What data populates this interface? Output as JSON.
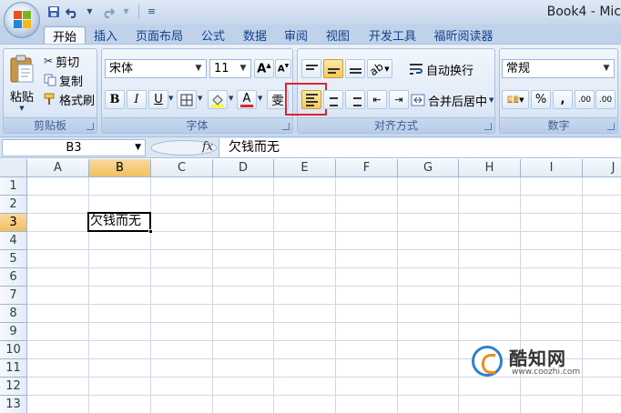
{
  "window": {
    "title": "Book4 - Mic"
  },
  "qat": {
    "save_icon": "save-icon",
    "undo_icon": "undo-icon",
    "redo_icon": "redo-icon"
  },
  "tabs": [
    {
      "label": "开始",
      "active": true
    },
    {
      "label": "插入"
    },
    {
      "label": "页面布局"
    },
    {
      "label": "公式"
    },
    {
      "label": "数据"
    },
    {
      "label": "审阅"
    },
    {
      "label": "视图"
    },
    {
      "label": "开发工具"
    },
    {
      "label": "福昕阅读器"
    }
  ],
  "clipboard": {
    "label": "剪贴板",
    "paste": "粘贴",
    "cut": "剪切",
    "copy": "复制",
    "format_painter": "格式刷"
  },
  "font": {
    "label": "字体",
    "name": "宋体",
    "size": "11",
    "bold": "B",
    "italic": "I",
    "underline": "U",
    "font_color_glyph": "A",
    "phonetic_glyph": "雯"
  },
  "alignment": {
    "label": "对齐方式",
    "wrap_text": "自动换行",
    "merge_center": "合并后居中",
    "highlighted_button": "align-left"
  },
  "number": {
    "label": "数字",
    "format": "常规",
    "percent": "%",
    "comma": ",",
    "inc_decimal": ".00",
    "dec_decimal": ".00"
  },
  "formula_bar": {
    "name_box": "B3",
    "fx": "fx",
    "content": "欠钱而无"
  },
  "grid": {
    "columns": [
      "A",
      "B",
      "C",
      "D",
      "E",
      "F",
      "G",
      "H",
      "I",
      "J"
    ],
    "rows": [
      "1",
      "2",
      "3",
      "4",
      "5",
      "6",
      "7",
      "8",
      "9",
      "10",
      "11",
      "12",
      "13"
    ],
    "selected_column": "B",
    "selected_row": "3",
    "active_cell_value": "欠钱而无"
  },
  "watermark": {
    "name": "酷知网",
    "url": "www.coozhi.com"
  },
  "colors": {
    "highlight": "#e0242a",
    "selected_header": "#f1c15f"
  }
}
